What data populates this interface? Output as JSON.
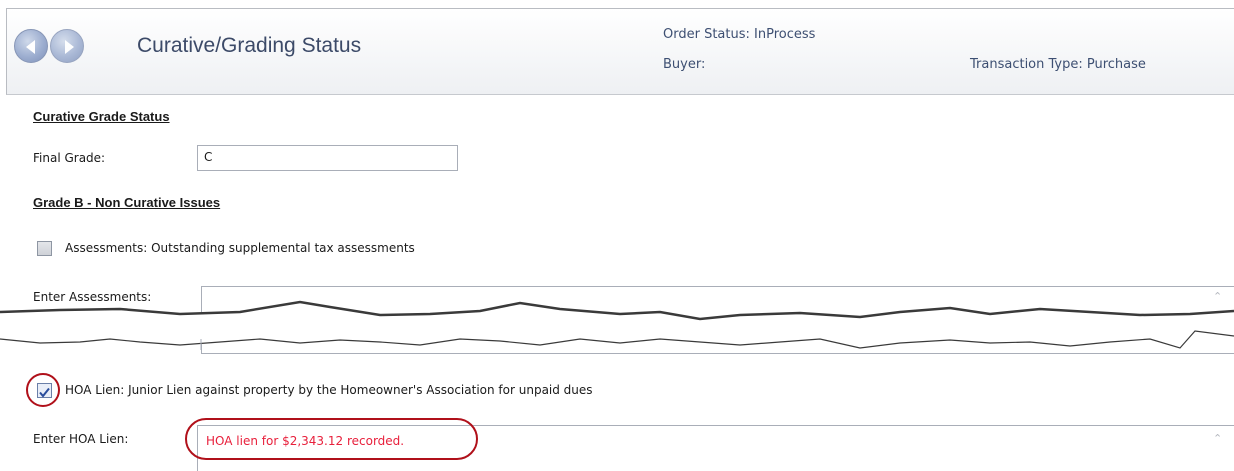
{
  "header": {
    "title": "Curative/Grading Status",
    "order_status": "Order Status: InProcess",
    "buyer": "Buyer:",
    "transaction_type": "Transaction Type: Purchase"
  },
  "curative": {
    "section_title": "Curative Grade Status",
    "final_grade_label": "Final Grade:",
    "final_grade_value": "C"
  },
  "grade_b": {
    "section_title": "Grade B  -  Non Curative Issues",
    "assessments_label": "Assessments:  Outstanding supplemental tax assessments",
    "assessments_checked": false,
    "enter_assessments_label": "Enter Assessments:",
    "assessments_value": ""
  },
  "hoa": {
    "label": "HOA Lien:  Junior Lien against property by the Homeowner's Association for unpaid dues",
    "checked": true,
    "enter_label": "Enter HOA Lien:",
    "value": "HOA lien for $2,343.12 recorded."
  },
  "colors": {
    "annotation_red": "#b0101a",
    "hoa_text": "#e8203c"
  },
  "icons": [
    "back-arrow-icon",
    "forward-arrow-icon",
    "checkmark-icon",
    "scroll-up-icon"
  ]
}
